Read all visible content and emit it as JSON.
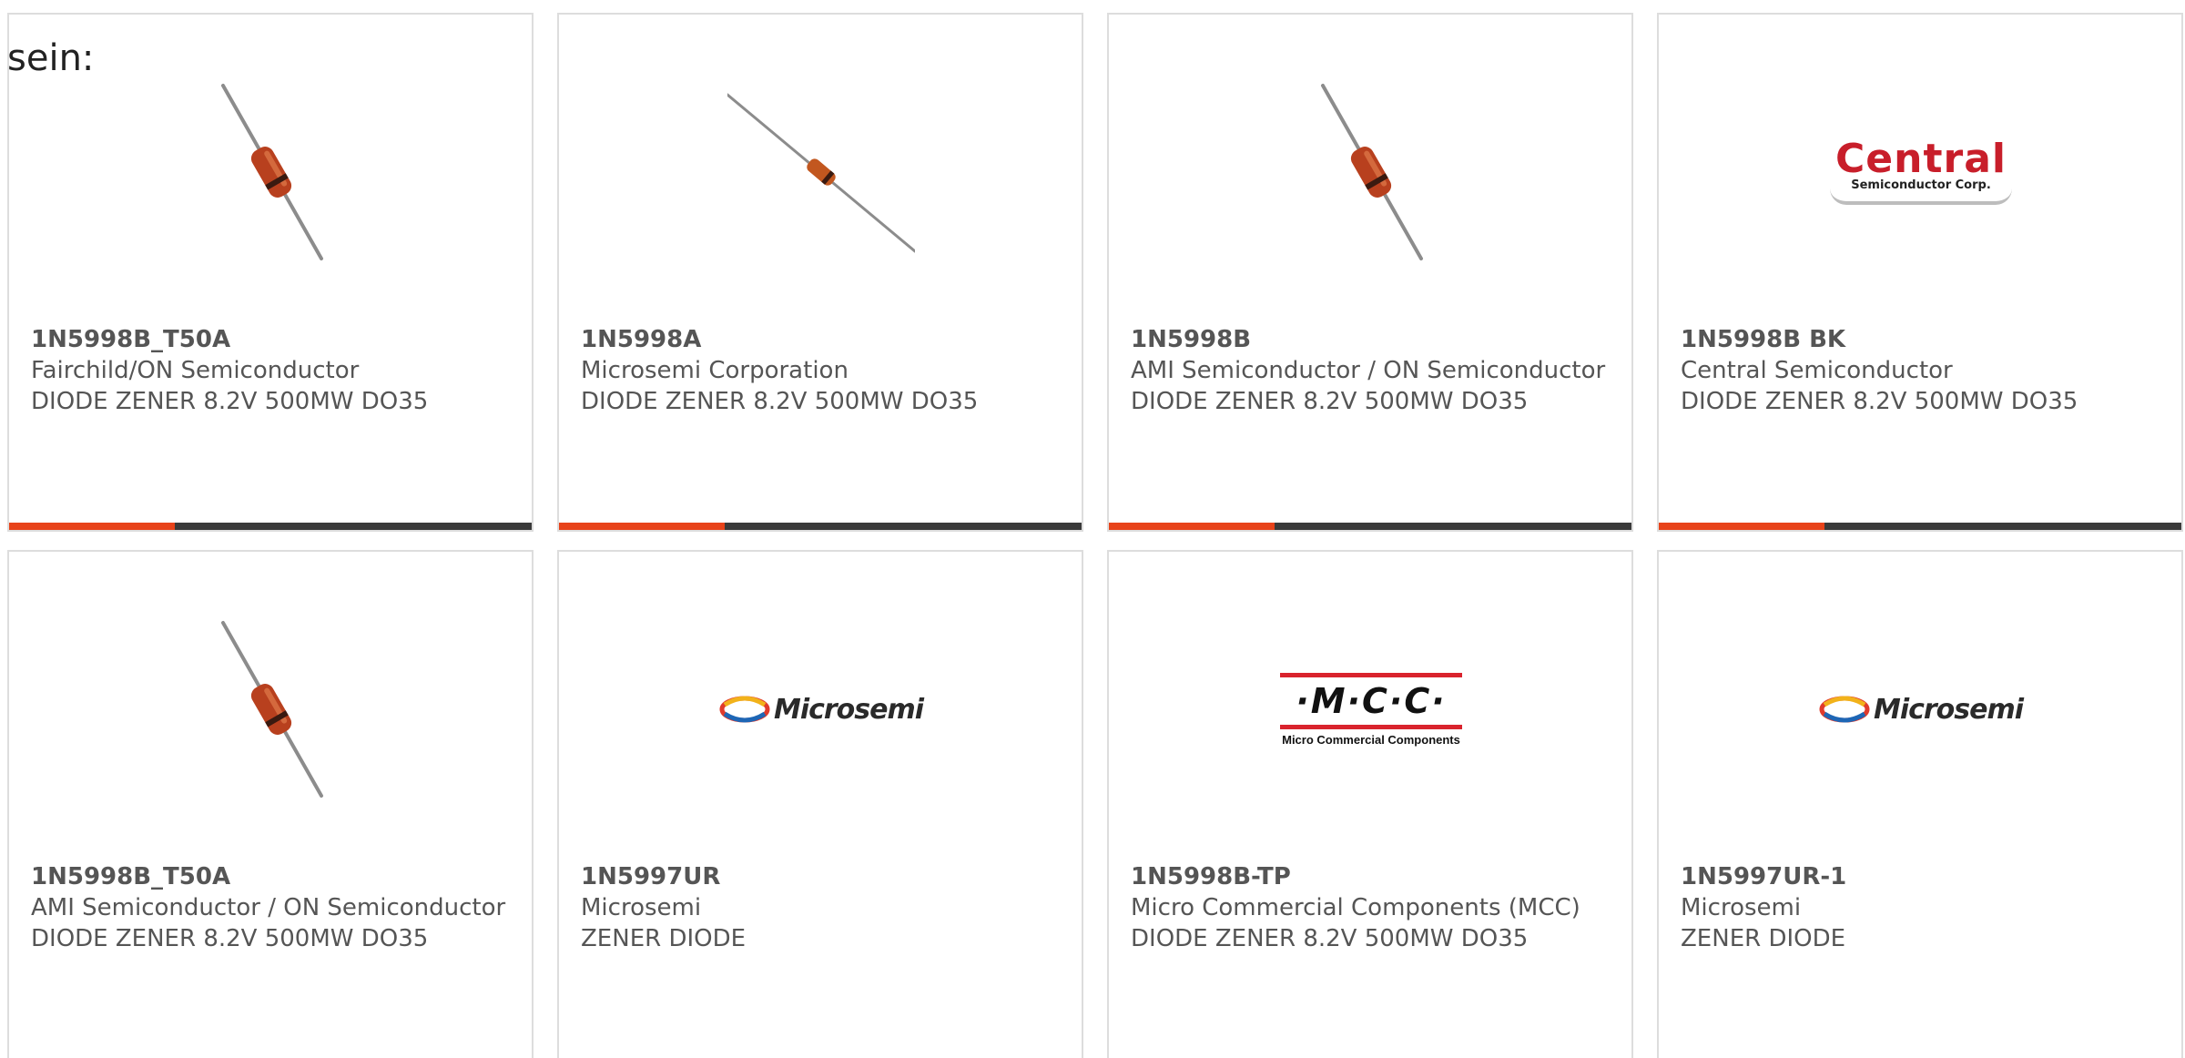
{
  "intro": {
    "text": "sein:"
  },
  "colors": {
    "accent": "#e8431a",
    "bar": "#3a3a3a",
    "border": "#dddddd",
    "text": "#555555"
  },
  "products": [
    {
      "part": "1N5998B_T50A",
      "manufacturer": "Fairchild/ON Semiconductor",
      "description": "DIODE ZENER 8.2V 500MW DO35",
      "image": "diode-photo-diagonal"
    },
    {
      "part": "1N5998A",
      "manufacturer": "Microsemi Corporation",
      "description": "DIODE ZENER 8.2V 500MW DO35",
      "image": "diode-photo-horizontal"
    },
    {
      "part": "1N5998B",
      "manufacturer": "AMI Semiconductor / ON Semiconductor",
      "description": "DIODE ZENER 8.2V 500MW DO35",
      "image": "diode-photo-diagonal"
    },
    {
      "part": "1N5998B BK",
      "manufacturer": "Central Semiconductor",
      "description": "DIODE ZENER 8.2V 500MW DO35",
      "image": "central-logo",
      "logo_word": "Central",
      "logo_sub": "Semiconductor Corp."
    },
    {
      "part": "1N5998B_T50A",
      "manufacturer": "AMI Semiconductor / ON Semiconductor",
      "description": "DIODE ZENER 8.2V 500MW DO35",
      "image": "diode-photo-diagonal"
    },
    {
      "part": "1N5997UR",
      "manufacturer": "Microsemi",
      "description": "ZENER DIODE",
      "image": "microsemi-logo",
      "logo_word": "Microsemi"
    },
    {
      "part": "1N5998B-TP",
      "manufacturer": "Micro Commercial Components (MCC)",
      "description": "DIODE ZENER 8.2V 500MW DO35",
      "image": "mcc-logo",
      "logo_word": "·M·C·C·",
      "logo_sub": "Micro Commercial Components"
    },
    {
      "part": "1N5997UR-1",
      "manufacturer": "Microsemi",
      "description": "ZENER DIODE",
      "image": "microsemi-logo",
      "logo_word": "Microsemi"
    }
  ]
}
